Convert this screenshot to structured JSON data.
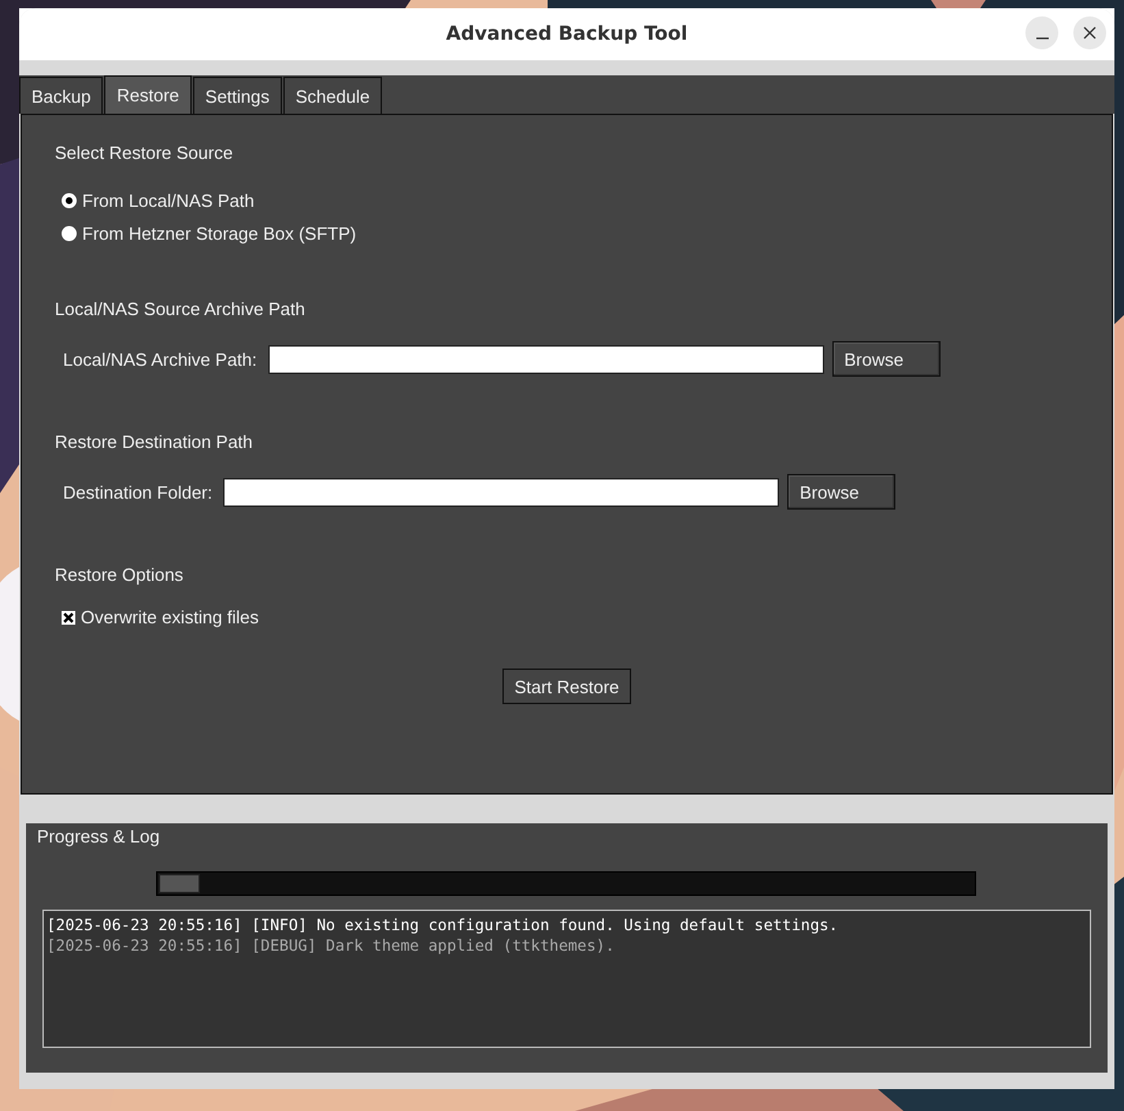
{
  "window": {
    "title": "Advanced Backup Tool"
  },
  "tabs": [
    {
      "label": "Backup",
      "selected": false
    },
    {
      "label": "Restore",
      "selected": true
    },
    {
      "label": "Settings",
      "selected": false
    },
    {
      "label": "Schedule",
      "selected": false
    }
  ],
  "restore": {
    "source_heading": "Select Restore Source",
    "sources": [
      {
        "label": "From Local/NAS Path",
        "selected": true
      },
      {
        "label": "From Hetzner Storage Box (SFTP)",
        "selected": false
      }
    ],
    "path_sections": [
      {
        "heading": "Local/NAS Source Archive Path",
        "field_label": "Local/NAS Archive Path:",
        "button": "Browse"
      },
      {
        "heading": "Restore Destination Path",
        "field_label": "Destination Folder:",
        "button": "Browse"
      }
    ],
    "options_heading": "Restore Options",
    "options": [
      {
        "label": "Overwrite existing files",
        "checked": true
      }
    ],
    "start_button": "Start Restore"
  },
  "progress": {
    "title": "Progress & Log",
    "level": 0.05,
    "log": [
      {
        "kind": "info",
        "text": "[2025-06-23 20:55:16] [INFO] No existing configuration found. Using default settings."
      },
      {
        "kind": "debug",
        "text": "[2025-06-23 20:55:16] [DEBUG] Dark theme applied (ttkthemes)."
      }
    ]
  }
}
